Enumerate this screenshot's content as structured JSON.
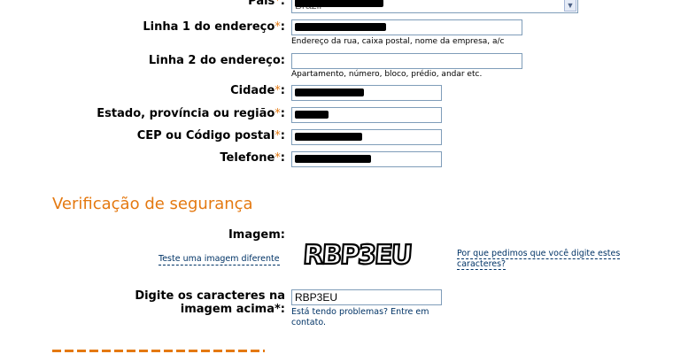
{
  "address_form": {
    "country": {
      "label": "País",
      "required_mark": "*",
      "value": "Brazil"
    },
    "line1": {
      "label": "Linha 1 do endereço",
      "required_mark": "*",
      "value": "5181995940",
      "hint": "Endereço da rua, caixa postal, nome da empresa, a/c"
    },
    "line2": {
      "label": "Linha 2 do endereço:",
      "value": "",
      "hint": "Apartamento, número, bloco, prédio, andar etc."
    },
    "city": {
      "label": "Cidade",
      "required_mark": "*",
      "value": "Guaiba"
    },
    "state": {
      "label": "Estado, província ou região",
      "required_mark": "*",
      "value": "RS"
    },
    "zip": {
      "label": "CEP ou Código postal",
      "required_mark": "*",
      "value": "92500000"
    },
    "phone": {
      "label": "Telefone",
      "required_mark": "*",
      "value": "5181995940"
    }
  },
  "security": {
    "title": "Verificação de segurança",
    "image_label": "Imagem:",
    "captcha_text": "RBP3EU",
    "try_other_link": "Teste uma imagem diferente",
    "why_link": "Por que pedimos que você digite estes caracteres?",
    "input_label": "Digite os caracteres na imagem acima",
    "input_required_mark": "*:",
    "input_value": "RBP3EU",
    "help_text": "Está tendo problemas? Entre em contato."
  },
  "colors": {
    "accent": "#e47911",
    "link": "#003366",
    "input_border": "#7f9db9"
  }
}
